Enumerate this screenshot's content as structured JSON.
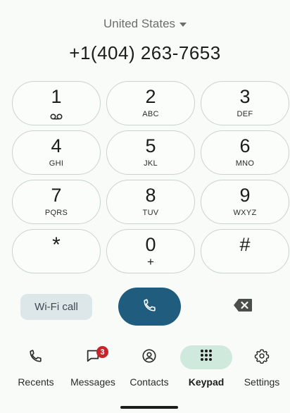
{
  "header": {
    "country": "United States",
    "phone_number": "+1(404) 263-7653"
  },
  "keypad": {
    "keys": [
      {
        "digit": "1",
        "letters": "",
        "icon": "voicemail-icon"
      },
      {
        "digit": "2",
        "letters": "ABC"
      },
      {
        "digit": "3",
        "letters": "DEF"
      },
      {
        "digit": "4",
        "letters": "GHI"
      },
      {
        "digit": "5",
        "letters": "JKL"
      },
      {
        "digit": "6",
        "letters": "MNO"
      },
      {
        "digit": "7",
        "letters": "PQRS"
      },
      {
        "digit": "8",
        "letters": "TUV"
      },
      {
        "digit": "9",
        "letters": "WXYZ"
      },
      {
        "digit": "*",
        "letters": ""
      },
      {
        "digit": "0",
        "letters": "+"
      },
      {
        "digit": "#",
        "letters": ""
      }
    ]
  },
  "actions": {
    "wifi_call_label": "Wi-Fi call",
    "call_icon": "phone-icon",
    "backspace_icon": "backspace-icon",
    "call_color": "#1f5c7d"
  },
  "nav": {
    "items": [
      {
        "label": "Recents",
        "icon": "phone-icon",
        "active": false
      },
      {
        "label": "Messages",
        "icon": "message-icon",
        "active": false,
        "badge": "3"
      },
      {
        "label": "Contacts",
        "icon": "contacts-icon",
        "active": false
      },
      {
        "label": "Keypad",
        "icon": "dialpad-icon",
        "active": true
      },
      {
        "label": "Settings",
        "icon": "gear-icon",
        "active": false
      }
    ],
    "active_color": "#cfe9dc",
    "badge_color": "#c5262b"
  }
}
